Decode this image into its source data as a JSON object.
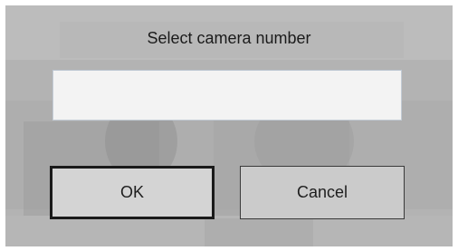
{
  "dialog": {
    "title": "Select camera number",
    "input": {
      "value": "",
      "placeholder": ""
    },
    "buttons": {
      "ok_label": "OK",
      "cancel_label": "Cancel"
    }
  },
  "colors": {
    "dialog_background": "#b2b2b2",
    "input_background": "#f3f3f3",
    "default_button_border": "#1a1a1a"
  }
}
